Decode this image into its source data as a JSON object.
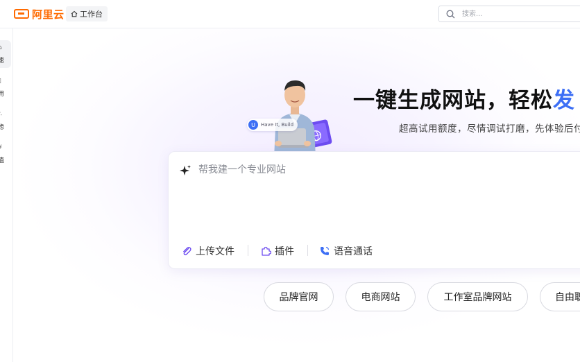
{
  "app": {
    "logo_text": "阿里云",
    "brand_color": "#ff6a00"
  },
  "topbar": {
    "workbench_label": "工作台",
    "workbench_icon": "home-icon",
    "search_placeholder": "搜索..."
  },
  "sidebar": {
    "items": [
      {
        "glyph_top": "⌂",
        "label": "速",
        "active": true
      },
      {
        "glyph_top": "▯",
        "label": "用",
        "active": false
      },
      {
        "glyph_top": "∴",
        "label": "虑",
        "active": false
      },
      {
        "glyph_top": "¥",
        "label": "值",
        "active": false
      }
    ]
  },
  "hero": {
    "title_main": "一键生成网站，轻松",
    "title_highlight": "发",
    "highlight_color": "#3d6ff5",
    "subtitle": "超高试用额度，尽情调试打磨，先体验后付",
    "badge_text": "Have It, Build"
  },
  "prompt": {
    "placeholder": "帮我建一个专业网站",
    "tools": [
      {
        "label": "上传文件",
        "icon": "paperclip-icon"
      },
      {
        "label": "插件",
        "icon": "puzzle-icon"
      },
      {
        "label": "语音通话",
        "icon": "phone-icon"
      }
    ]
  },
  "templates": [
    {
      "label": "品牌官网"
    },
    {
      "label": "电商网站"
    },
    {
      "label": "工作室品牌网站"
    },
    {
      "label": "自由职"
    }
  ]
}
